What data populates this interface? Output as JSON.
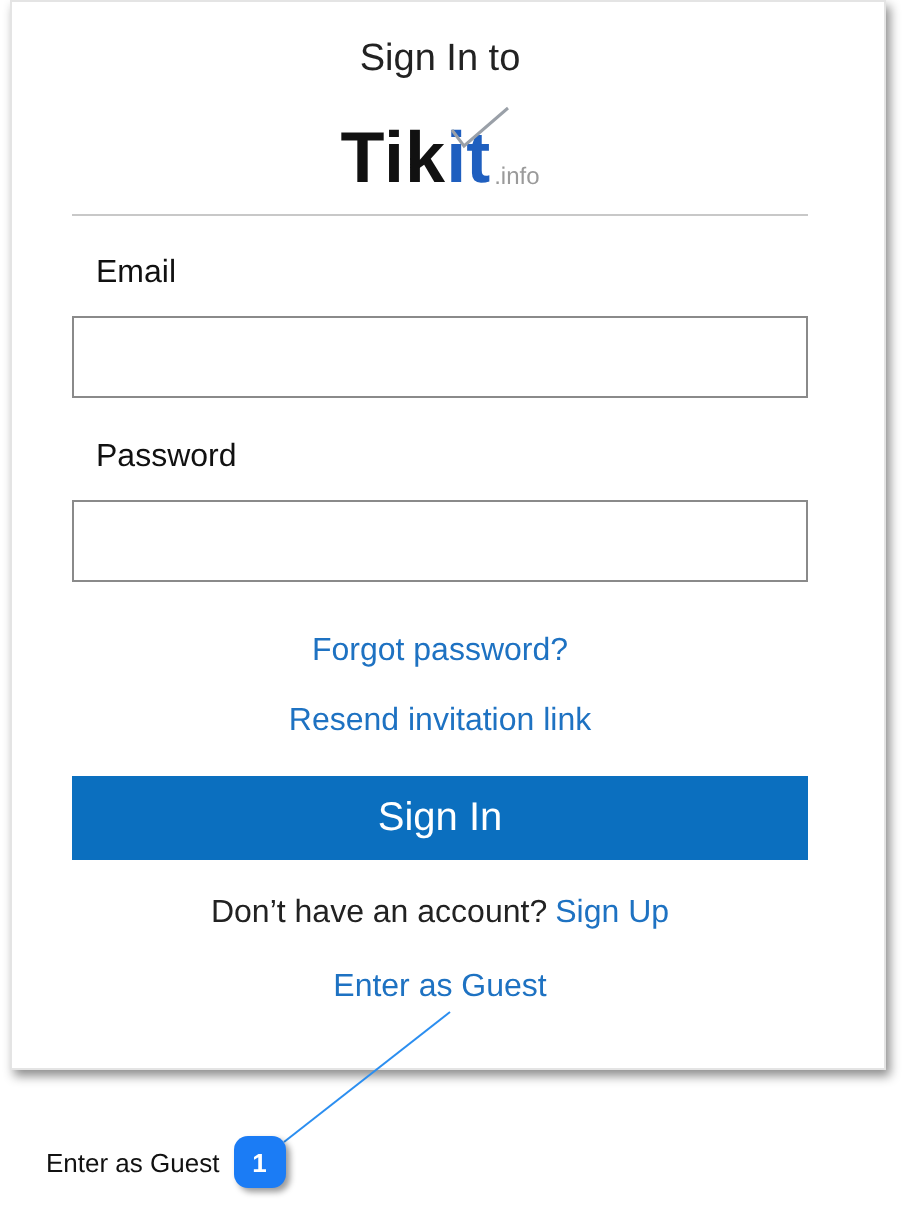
{
  "title": "Sign In to",
  "logo": {
    "main": "Tik",
    "accent": "it",
    "suffix": ".info"
  },
  "fields": [
    {
      "label": "Email"
    },
    {
      "label": "Password"
    }
  ],
  "links": [
    "Forgot password?",
    "Resend invitation link"
  ],
  "submit": "Sign In",
  "signup": {
    "prompt": "Don’t have an account?",
    "link": "Sign Up"
  },
  "guest_link": "Enter as Guest",
  "callout": {
    "number": "1",
    "text": "Enter as Guest"
  }
}
